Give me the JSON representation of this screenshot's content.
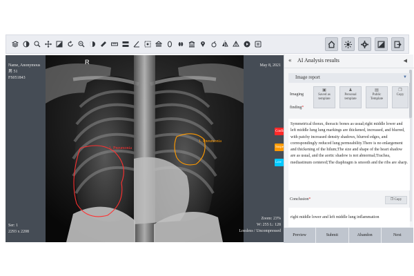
{
  "toolbar": {
    "left_tools": [
      "layers-icon",
      "contrast-icon",
      "zoom-icon",
      "pan-icon",
      "window-level-icon",
      "rotate-icon",
      "magnify-icon",
      "invert-icon",
      "ruler-icon",
      "probe-icon",
      "layout-icon",
      "angle-icon",
      "roi-icon",
      "stack-icon",
      "ellipse-icon",
      "organ-icon",
      "reference-icon",
      "pin-icon",
      "cobb-icon",
      "flip-icon",
      "3d-icon",
      "cine-icon",
      "settings-icon"
    ],
    "right_tools": [
      "home-icon",
      "brightness-icon",
      "gear-icon",
      "sync-icon",
      "exit-icon"
    ]
  },
  "viewer": {
    "patient_name": "Name, Anonymous",
    "patient_sex_age": "男  51",
    "patient_id": "FS051843",
    "date": "May 8, 2021",
    "orientation": "R",
    "series": "Ser: 1",
    "dimensions": "2293 x 2208",
    "zoom": "Zoom: 23%",
    "window": "W: 255 L: 128",
    "compression": "Lossless / Uncompressed",
    "annotation_left": "1. Pneumonia",
    "annotation_right": "1. Pneumonia",
    "flags": [
      {
        "label": "Confirmed",
        "color": "#ff2a2a"
      },
      {
        "label": "Suspected",
        "color": "#ff9900"
      },
      {
        "label": "Low",
        "color": "#00c8ff"
      }
    ]
  },
  "panel": {
    "collapse_icon": "«",
    "title": "AI Analysis results",
    "section_title": "Image report",
    "finding_label": "Imaging finding",
    "required_mark": "*",
    "templates": [
      {
        "label": "Saved as template",
        "icon": "save-icon"
      },
      {
        "label": "Personal template",
        "icon": "user-icon"
      },
      {
        "label": "Public Template",
        "icon": "doc-icon"
      },
      {
        "label": "Copy",
        "icon": "copy-icon"
      }
    ],
    "finding_text": "Symmetrical thorax, thoracic bones as usual;right middle lower and left middle lung lung markings are thickened, increased, and blurred, with patchy increased density shadows, blurred edges, and correspondingly reduced lung permeability.There is no enlargement and thickening of the hilum;The size and shape of the heart shadow are as usual, and the aortic shadow is not abnormal;Trachea, mediastinum centered;The diaphragm is smooth and the ribs are sharp.",
    "conclusion_label": "Conclusion",
    "copy_label": "Copy",
    "conclusion_text": "right middle lower and left middle lung inflammation"
  },
  "actions": [
    "Preview",
    "Submit",
    "Abandon",
    "Next"
  ]
}
